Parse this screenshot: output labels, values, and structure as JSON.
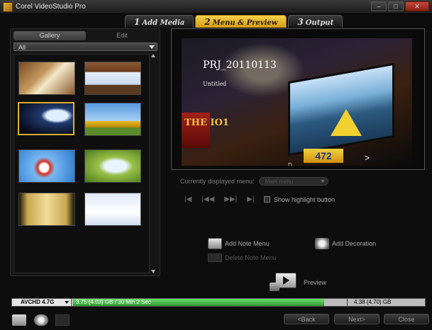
{
  "window": {
    "title": "Corel VideoStudio Pro",
    "controls": [
      "–",
      "□",
      "✕"
    ]
  },
  "steps": [
    {
      "num": "1",
      "label": "Add Media"
    },
    {
      "num": "2",
      "label": "Menu & Preview"
    },
    {
      "num": "3",
      "label": "Output"
    }
  ],
  "left": {
    "tabs": [
      "Gallery",
      "Edit"
    ],
    "category": "All",
    "thumbnails": [
      {
        "name": "thumb-book-template"
      },
      {
        "name": "thumb-film-frames-template"
      },
      {
        "name": "thumb-billboard-night-template"
      },
      {
        "name": "thumb-bus-template"
      },
      {
        "name": "thumb-airplane-template"
      },
      {
        "name": "thumb-leaf-template"
      },
      {
        "name": "thumb-gold-frame-template"
      },
      {
        "name": "thumb-light-blue-template"
      }
    ]
  },
  "preview": {
    "title": "PRJ_20110113",
    "subtitle": "Untitled",
    "sign_text": "THE IO1",
    "sign_number": "472",
    "nav_label": "D",
    "nav_arrow": ">"
  },
  "menu": {
    "label": "Currently displayed menu:",
    "value": "Main menu"
  },
  "transport": [
    "|◀",
    "|◀◀",
    "▶▶|",
    "▶|"
  ],
  "highlight": {
    "label": "Show highlight button"
  },
  "actions": {
    "add_note": "Add Note Menu",
    "delete_note": "Delete Note Menu",
    "add_decoration": "Add Decoration",
    "preview": "Preview"
  },
  "disc": {
    "type": "AVCHD 4.7G",
    "used": "3.75 (4.03) GB / 30 Min 2 Sec",
    "capacity": "4.38 (4.70) GB",
    "used_fraction": 0.86
  },
  "footer": {
    "back": "<Back",
    "next": "Next>",
    "close": "Close"
  }
}
